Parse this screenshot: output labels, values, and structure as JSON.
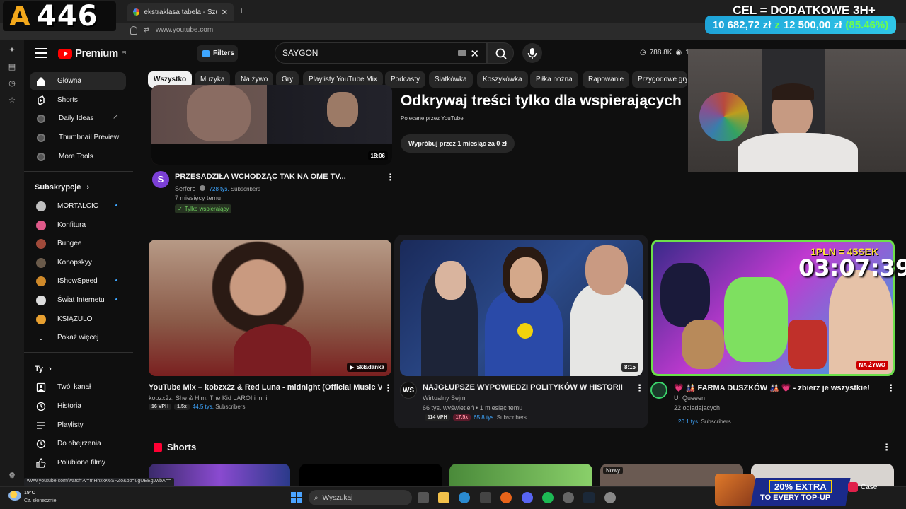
{
  "browser": {
    "tabs": [
      {
        "label": "ekstraklasa tabela - Szukaj w Go"
      }
    ],
    "url": "www.youtube.com",
    "status_url": "www.youtube.com/watch?v=mHhxkK6SFZo&pp=ugUEEgJwbA=="
  },
  "overlay": {
    "logo_a": "A",
    "logo_num": "446",
    "goal_title": "CEL = DODATKOWE 3H+",
    "goal_current": "10 682,72 zł",
    "goal_sep": "z",
    "goal_target": "12 500,00 zł",
    "goal_percent": "(85.46%)",
    "goal_fraction": 0.8546
  },
  "header": {
    "logo_text": "Premium",
    "logo_region": "PL",
    "filters_label": "Filters",
    "search_value": "SAYGON",
    "stats_views": "788.8K",
    "stats_extra": "1"
  },
  "sidebar": {
    "main": [
      {
        "label": "Główna",
        "icon": "home-icon"
      },
      {
        "label": "Shorts",
        "icon": "shorts-icon"
      },
      {
        "label": "Daily Ideas",
        "icon": "extension-icon"
      },
      {
        "label": "Thumbnail Preview",
        "icon": "extension-icon"
      },
      {
        "label": "More Tools",
        "icon": "extension-icon"
      }
    ],
    "subs_header": "Subskrypcje",
    "subs": [
      {
        "label": "MORTALCIO",
        "color": "#c0c0c0",
        "live": true
      },
      {
        "label": "Konfitura",
        "color": "#e05a8a",
        "live": false
      },
      {
        "label": "Bungee",
        "color": "#a04a3a",
        "live": false
      },
      {
        "label": "Konopskyy",
        "color": "#6a5a4a",
        "live": false
      },
      {
        "label": "IShowSpeed",
        "color": "#d08a2a",
        "live": true
      },
      {
        "label": "Świat Internetu",
        "color": "#ddd",
        "live": true
      },
      {
        "label": "KSIĄŻULO",
        "color": "#e8a030",
        "live": false
      }
    ],
    "show_more": "Pokaż więcej",
    "you_header": "Ty",
    "you": [
      {
        "label": "Twój kanał",
        "icon": "user-icon"
      },
      {
        "label": "Historia",
        "icon": "history-icon"
      },
      {
        "label": "Playlisty",
        "icon": "playlist-icon"
      },
      {
        "label": "Do obejrzenia",
        "icon": "clock-icon"
      },
      {
        "label": "Polubione filmy",
        "icon": "like-icon"
      }
    ]
  },
  "chips": [
    "Wszystko",
    "Muzyka",
    "Na żywo",
    "Gry",
    "Playlisty YouTube Mix",
    "Podcasty",
    "Siatkówka",
    "Koszykówka",
    "Piłka nożna",
    "Rapowanie",
    "Przygodowe gry a"
  ],
  "top_video": {
    "duration": "18:06",
    "title": "PRZESADZIŁA WCHODZĄC TAK NA OME TV...",
    "channel": "Serfero",
    "subs_count": "728 tys.",
    "subs_word": "Subscribers",
    "age": "7 miesięcy temu",
    "badge": "Tylko wspierający"
  },
  "promo_banner": {
    "heading": "Odkrywaj treści tylko dla wspierających",
    "sub": "Polecane przez YouTube",
    "button": "Wypróbuj przez 1 miesiąc za 0 zł"
  },
  "videos": [
    {
      "title": "YouTube Mix – kobzx2z & Red Luna - midnight (Official Music Video)",
      "line1": "kobzx2z, She & Him, The Kid LAROI i inni",
      "vph": "16 VPH",
      "ratio": "1.5x",
      "subs": "44.5 tys.",
      "subs_word": "Subscribers",
      "badge": "Składanka"
    },
    {
      "title": "NAJGŁUPSZE WYPOWIEDZI POLITYKÓW W HISTORII",
      "channel": "Wirtualny Sejm",
      "avatar": "WS",
      "line1": "66 tys. wyświetleń • 1 miesiąc temu",
      "vph": "114 VPH",
      "ratio": "17.5x",
      "subs": "65.8 tys.",
      "subs_word": "Subscribers",
      "duration": "8:15"
    },
    {
      "title": "💗 🎎 FARMA DUSZKÓW 🎎 💗 - zbierz je wszystkie!",
      "channel": "Ur Queeen",
      "line1": "22 oglądających",
      "subs": "20.1 tys.",
      "subs_word": "Subscribers",
      "live": "NA ŻYWO",
      "overlay_price": "1PLN = 45SEK",
      "overlay_timer": "03:07:39"
    }
  ],
  "shorts": {
    "header": "Shorts",
    "new_badge": "Nowy"
  },
  "taskbar": {
    "temp": "19°C",
    "weather": "Cz. słonecznie",
    "search": "Wyszukaj",
    "promo_extra": "20% EXTRA",
    "promo_topup": "TO EVERY TOP-UP",
    "promo_brand": "Case"
  }
}
